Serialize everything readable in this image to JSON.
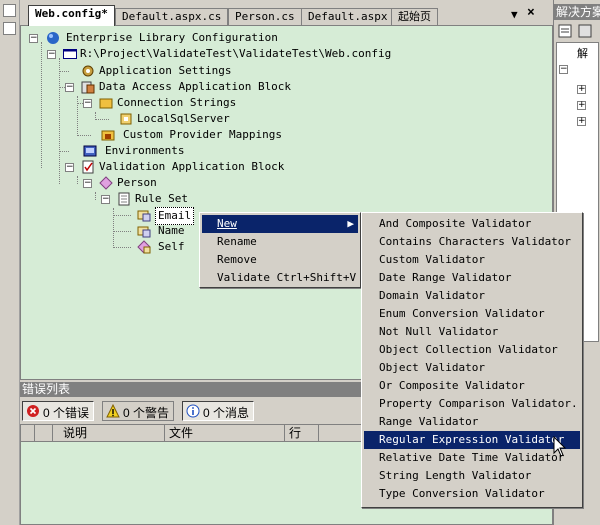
{
  "tabs": {
    "items": [
      "Web.config*",
      "Default.aspx.cs",
      "Person.cs",
      "Default.aspx",
      "起始页"
    ],
    "dropdown": "▼",
    "close": "×"
  },
  "tree": {
    "root": "Enterprise Library Configuration",
    "file": "R:\\Project\\ValidateTest\\ValidateTest\\Web.config",
    "app_settings": "Application Settings",
    "daab": "Data Access Application Block",
    "conn_strings": "Connection Strings",
    "local_sql": "LocalSqlServer",
    "provider_mappings": "Custom Provider Mappings",
    "environments": "Environments",
    "vab": "Validation Application Block",
    "person": "Person",
    "rule_set": "Rule Set",
    "email": "Email",
    "name": "Name",
    "self": "Self"
  },
  "context_menu": {
    "new_label": "New",
    "new_arrow": "▶",
    "rename": "Rename",
    "remove": "Remove",
    "validate": "Validate Ctrl+Shift+V"
  },
  "new_submenu": {
    "items": [
      "And Composite Validator",
      "Contains Characters Validator",
      "Custom Validator",
      "Date Range Validator",
      "Domain Validator",
      "Enum Conversion Validator",
      "Not Null Validator",
      "Object Collection Validator",
      "Object Validator",
      "Or Composite Validator",
      "Property Comparison Validator.",
      "Range Validator",
      "Regular Expression Validator",
      "Relative Date Time Validator",
      "String Length Validator",
      "Type Conversion Validator"
    ],
    "highlighted": "Regular Expression Validator"
  },
  "error_list": {
    "title": "错误列表",
    "errors_btn": "0 个错误",
    "warnings_btn": "0 个警告",
    "messages_btn": "0 个消息",
    "columns": [
      "说明",
      "文件",
      "行"
    ]
  },
  "right_pane": {
    "title": "解决方案",
    "tree_label": "解"
  },
  "colors": {
    "editor_bg": "#d6ecd6",
    "menu_highlight": "#0a246a"
  }
}
